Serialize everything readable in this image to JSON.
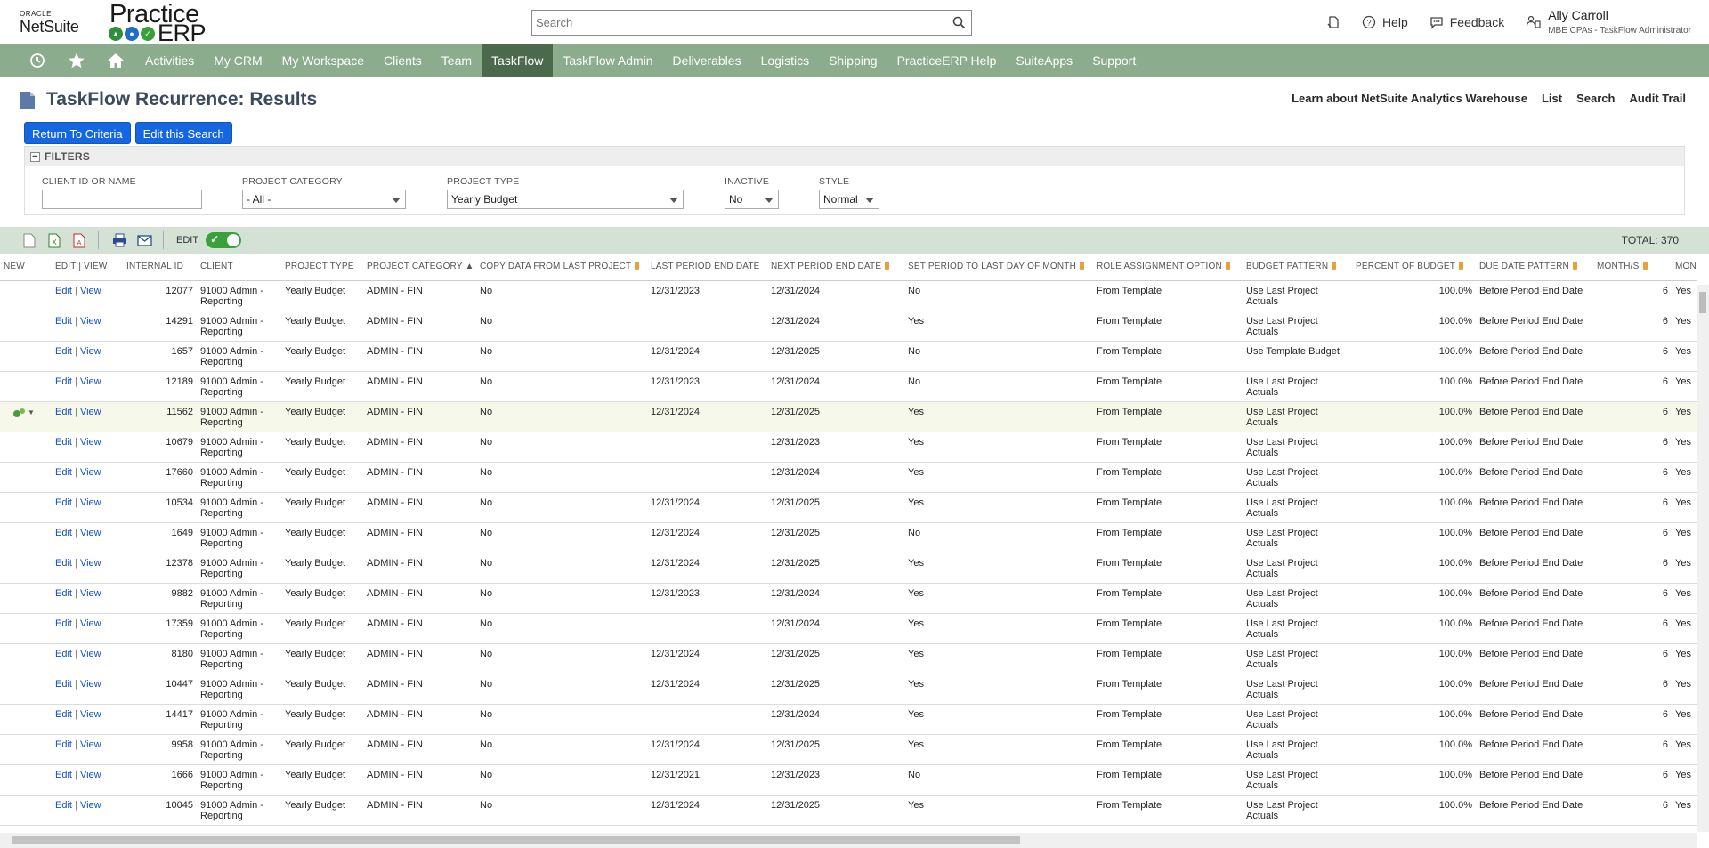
{
  "brand": {
    "oracle": "ORACLE",
    "netsuite": "NetSuite",
    "practice": "Practice",
    "erp": "ERP"
  },
  "search": {
    "placeholder": "Search"
  },
  "header": {
    "help": "Help",
    "feedback": "Feedback",
    "user_name": "Ally Carroll",
    "user_role": "MBE CPAs - TaskFlow Administrator"
  },
  "nav": {
    "items": [
      "Activities",
      "My CRM",
      "My Workspace",
      "Clients",
      "Team",
      "TaskFlow",
      "TaskFlow Admin",
      "Deliverables",
      "Logistics",
      "Shipping",
      "PracticeERP Help",
      "SuiteApps",
      "Support"
    ],
    "active": "TaskFlow",
    "icons": [
      "recent-icon",
      "star-icon",
      "home-icon"
    ]
  },
  "page": {
    "title": "TaskFlow Recurrence: Results",
    "links": [
      "Learn about NetSuite Analytics Warehouse",
      "List",
      "Search",
      "Audit Trail"
    ],
    "buttons": {
      "return": "Return To Criteria",
      "edit_search": "Edit this Search"
    }
  },
  "filters": {
    "heading": "FILTERS",
    "client_label": "CLIENT ID OR NAME",
    "client_value": "",
    "category_label": "PROJECT CATEGORY",
    "category_value": "- All -",
    "type_label": "PROJECT TYPE",
    "type_value": "Yearly Budget",
    "inactive_label": "INACTIVE",
    "inactive_value": "No",
    "style_label": "STYLE",
    "style_value": "Normal"
  },
  "toolbar": {
    "edit_label": "EDIT",
    "edit_on": true,
    "total": "TOTAL: 370"
  },
  "table": {
    "columns": [
      "NEW",
      "EDIT | VIEW",
      "INTERNAL ID",
      "CLIENT",
      "PROJECT TYPE",
      "PROJECT CATEGORY ▲",
      "COPY DATA FROM LAST PROJECT",
      "LAST PERIOD END DATE",
      "NEXT PERIOD END DATE",
      "SET PERIOD TO LAST DAY OF MONTH",
      "ROLE ASSIGNMENT OPTION",
      "BUDGET PATTERN",
      "PERCENT OF BUDGET",
      "DUE DATE PATTERN",
      "MONTH/S",
      "MONTH"
    ],
    "edit_label": "Edit",
    "view_label": "View",
    "rows": [
      {
        "id": "12077",
        "client": "91000 Admin - Reporting",
        "type": "Yearly Budget",
        "category": "ADMIN - FIN",
        "copy": "No",
        "last": "12/31/2023",
        "next": "12/31/2024",
        "setlast": "No",
        "role": "From Template",
        "budget": "Use Last Project Actuals",
        "percent": "100.0%",
        "due": "Before Period End Date",
        "months": "6",
        "month": "Yes"
      },
      {
        "id": "14291",
        "client": "91000 Admin - Reporting",
        "type": "Yearly Budget",
        "category": "ADMIN - FIN",
        "copy": "No",
        "last": "",
        "next": "12/31/2024",
        "setlast": "Yes",
        "role": "From Template",
        "budget": "Use Last Project Actuals",
        "percent": "100.0%",
        "due": "Before Period End Date",
        "months": "6",
        "month": "Yes"
      },
      {
        "id": "1657",
        "client": "91000 Admin - Reporting",
        "type": "Yearly Budget",
        "category": "ADMIN - FIN",
        "copy": "No",
        "last": "12/31/2024",
        "next": "12/31/2025",
        "setlast": "No",
        "role": "From Template",
        "budget": "Use Template Budget",
        "percent": "100.0%",
        "due": "Before Period End Date",
        "months": "6",
        "month": "Yes"
      },
      {
        "id": "12189",
        "client": "91000 Admin - Reporting",
        "type": "Yearly Budget",
        "category": "ADMIN - FIN",
        "copy": "No",
        "last": "12/31/2023",
        "next": "12/31/2024",
        "setlast": "No",
        "role": "From Template",
        "budget": "Use Last Project Actuals",
        "percent": "100.0%",
        "due": "Before Period End Date",
        "months": "6",
        "month": "Yes"
      },
      {
        "id": "11562",
        "client": "91000 Admin - Reporting",
        "type": "Yearly Budget",
        "category": "ADMIN - FIN",
        "copy": "No",
        "last": "12/31/2024",
        "next": "12/31/2025",
        "setlast": "Yes",
        "role": "From Template",
        "budget": "Use Last Project Actuals",
        "percent": "100.0%",
        "due": "Before Period End Date",
        "months": "6",
        "month": "Yes",
        "highlight": true
      },
      {
        "id": "10679",
        "client": "91000 Admin - Reporting",
        "type": "Yearly Budget",
        "category": "ADMIN - FIN",
        "copy": "No",
        "last": "",
        "next": "12/31/2023",
        "setlast": "Yes",
        "role": "From Template",
        "budget": "Use Last Project Actuals",
        "percent": "100.0%",
        "due": "Before Period End Date",
        "months": "6",
        "month": "Yes"
      },
      {
        "id": "17660",
        "client": "91000 Admin - Reporting",
        "type": "Yearly Budget",
        "category": "ADMIN - FIN",
        "copy": "No",
        "last": "",
        "next": "12/31/2024",
        "setlast": "Yes",
        "role": "From Template",
        "budget": "Use Last Project Actuals",
        "percent": "100.0%",
        "due": "Before Period End Date",
        "months": "6",
        "month": "Yes"
      },
      {
        "id": "10534",
        "client": "91000 Admin - Reporting",
        "type": "Yearly Budget",
        "category": "ADMIN - FIN",
        "copy": "No",
        "last": "12/31/2024",
        "next": "12/31/2025",
        "setlast": "Yes",
        "role": "From Template",
        "budget": "Use Last Project Actuals",
        "percent": "100.0%",
        "due": "Before Period End Date",
        "months": "6",
        "month": "Yes"
      },
      {
        "id": "1649",
        "client": "91000 Admin - Reporting",
        "type": "Yearly Budget",
        "category": "ADMIN - FIN",
        "copy": "No",
        "last": "12/31/2024",
        "next": "12/31/2025",
        "setlast": "No",
        "role": "From Template",
        "budget": "Use Last Project Actuals",
        "percent": "100.0%",
        "due": "Before Period End Date",
        "months": "6",
        "month": "Yes"
      },
      {
        "id": "12378",
        "client": "91000 Admin - Reporting",
        "type": "Yearly Budget",
        "category": "ADMIN - FIN",
        "copy": "No",
        "last": "12/31/2024",
        "next": "12/31/2025",
        "setlast": "Yes",
        "role": "From Template",
        "budget": "Use Last Project Actuals",
        "percent": "100.0%",
        "due": "Before Period End Date",
        "months": "6",
        "month": "Yes"
      },
      {
        "id": "9882",
        "client": "91000 Admin - Reporting",
        "type": "Yearly Budget",
        "category": "ADMIN - FIN",
        "copy": "No",
        "last": "12/31/2023",
        "next": "12/31/2024",
        "setlast": "Yes",
        "role": "From Template",
        "budget": "Use Last Project Actuals",
        "percent": "100.0%",
        "due": "Before Period End Date",
        "months": "6",
        "month": "Yes"
      },
      {
        "id": "17359",
        "client": "91000 Admin - Reporting",
        "type": "Yearly Budget",
        "category": "ADMIN - FIN",
        "copy": "No",
        "last": "",
        "next": "12/31/2024",
        "setlast": "Yes",
        "role": "From Template",
        "budget": "Use Last Project Actuals",
        "percent": "100.0%",
        "due": "Before Period End Date",
        "months": "6",
        "month": "Yes"
      },
      {
        "id": "8180",
        "client": "91000 Admin - Reporting",
        "type": "Yearly Budget",
        "category": "ADMIN - FIN",
        "copy": "No",
        "last": "12/31/2024",
        "next": "12/31/2025",
        "setlast": "Yes",
        "role": "From Template",
        "budget": "Use Last Project Actuals",
        "percent": "100.0%",
        "due": "Before Period End Date",
        "months": "6",
        "month": "Yes"
      },
      {
        "id": "10447",
        "client": "91000 Admin - Reporting",
        "type": "Yearly Budget",
        "category": "ADMIN - FIN",
        "copy": "No",
        "last": "12/31/2024",
        "next": "12/31/2025",
        "setlast": "Yes",
        "role": "From Template",
        "budget": "Use Last Project Actuals",
        "percent": "100.0%",
        "due": "Before Period End Date",
        "months": "6",
        "month": "Yes"
      },
      {
        "id": "14417",
        "client": "91000 Admin - Reporting",
        "type": "Yearly Budget",
        "category": "ADMIN - FIN",
        "copy": "No",
        "last": "",
        "next": "12/31/2024",
        "setlast": "Yes",
        "role": "From Template",
        "budget": "Use Last Project Actuals",
        "percent": "100.0%",
        "due": "Before Period End Date",
        "months": "6",
        "month": "Yes"
      },
      {
        "id": "9958",
        "client": "91000 Admin - Reporting",
        "type": "Yearly Budget",
        "category": "ADMIN - FIN",
        "copy": "No",
        "last": "12/31/2024",
        "next": "12/31/2025",
        "setlast": "Yes",
        "role": "From Template",
        "budget": "Use Last Project Actuals",
        "percent": "100.0%",
        "due": "Before Period End Date",
        "months": "6",
        "month": "Yes"
      },
      {
        "id": "1666",
        "client": "91000 Admin - Reporting",
        "type": "Yearly Budget",
        "category": "ADMIN - FIN",
        "copy": "No",
        "last": "12/31/2021",
        "next": "12/31/2023",
        "setlast": "No",
        "role": "From Template",
        "budget": "Use Last Project Actuals",
        "percent": "100.0%",
        "due": "Before Period End Date",
        "months": "6",
        "month": "Yes"
      },
      {
        "id": "10045",
        "client": "91000 Admin - Reporting",
        "type": "Yearly Budget",
        "category": "ADMIN - FIN",
        "copy": "No",
        "last": "12/31/2024",
        "next": "12/31/2025",
        "setlast": "Yes",
        "role": "From Template",
        "budget": "Use Last Project Actuals",
        "percent": "100.0%",
        "due": "Before Period End Date",
        "months": "6",
        "month": "Yes"
      }
    ]
  },
  "colors": {
    "nav_bg": "#8bac8d",
    "nav_active": "#4b6a4d",
    "button": "#1467e0",
    "toolbar_bg": "#d3e2d5",
    "link": "#1150c8",
    "title": "#3b4a5c"
  }
}
